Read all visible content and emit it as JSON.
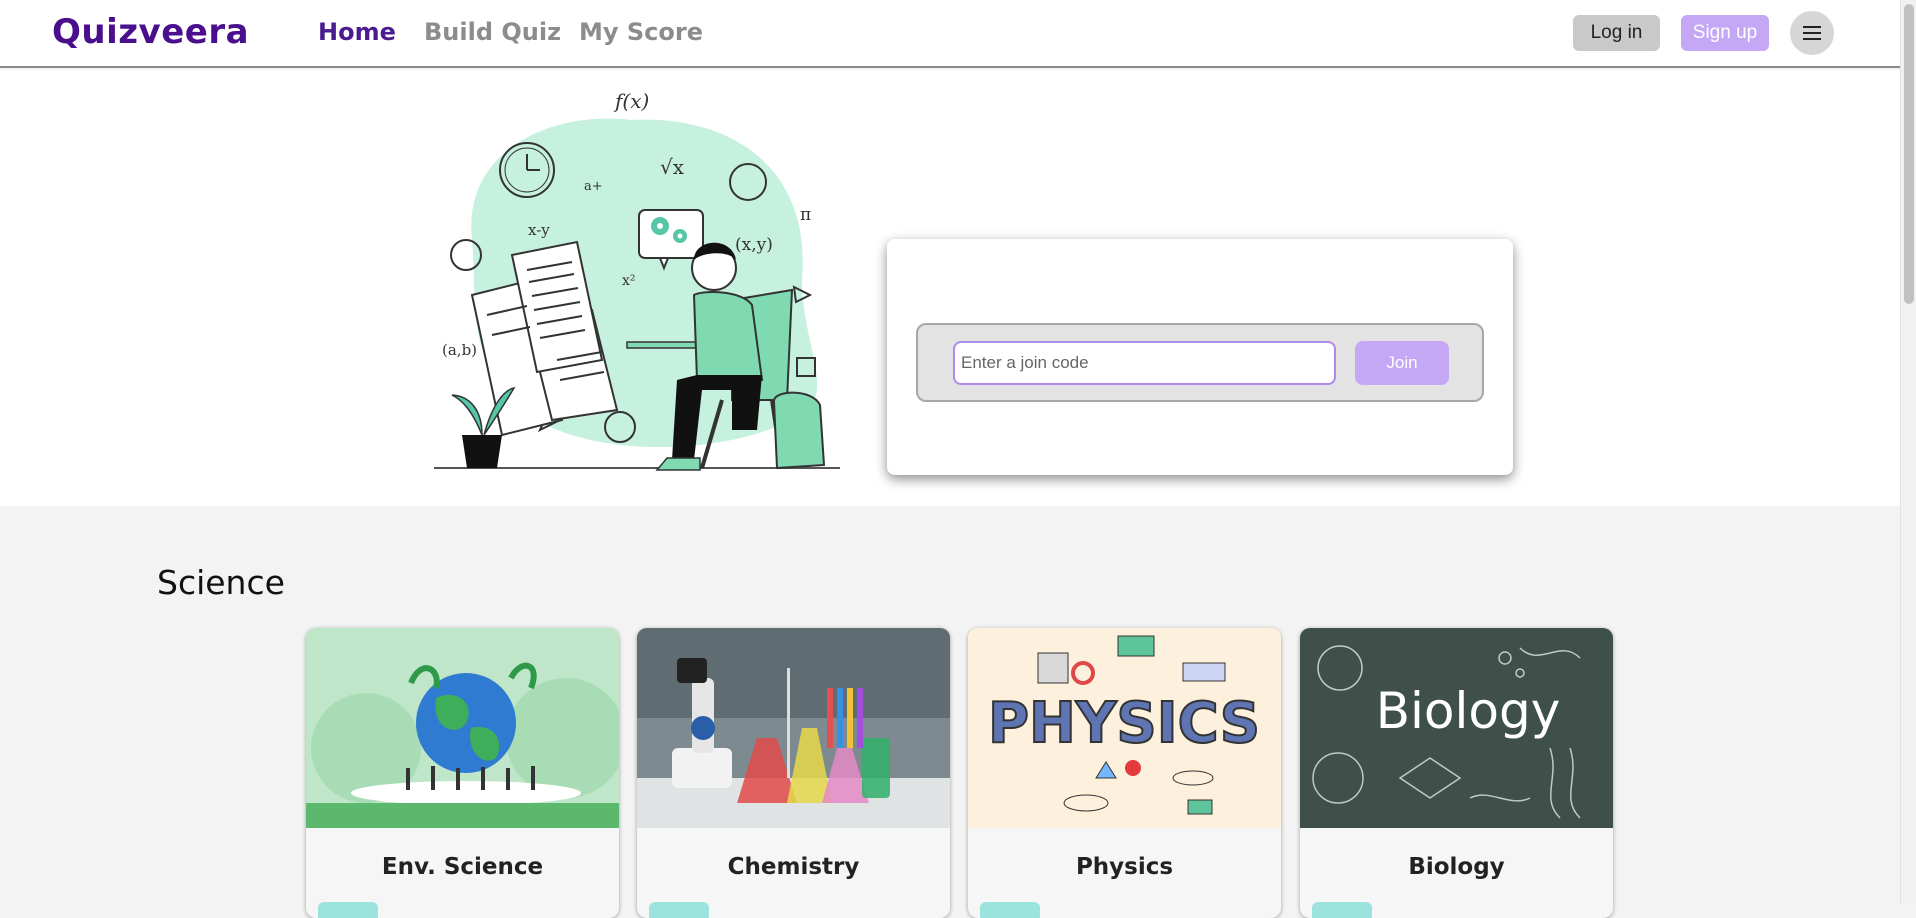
{
  "header": {
    "logo": "Quizveera",
    "nav": [
      {
        "label": "Home",
        "active": true
      },
      {
        "label": "Build Quiz",
        "active": false
      },
      {
        "label": "My Score",
        "active": false
      }
    ],
    "login_label": "Log in",
    "signup_label": "Sign up",
    "menu_icon": "hamburger-icon"
  },
  "join": {
    "placeholder": "Enter a join code",
    "value": "",
    "button_label": "Join"
  },
  "illustration": {
    "formula_labels": [
      "f(x)",
      "√x",
      "x-y",
      "(x,y)",
      "x²",
      "(a,b)",
      "π",
      "a+"
    ]
  },
  "section": {
    "title": "Science",
    "cards": [
      {
        "title": "Env. Science",
        "image": "earth-illustration"
      },
      {
        "title": "Chemistry",
        "image": "lab-equipment-photo"
      },
      {
        "title": "Physics",
        "image": "physics-doodles"
      },
      {
        "title": "Biology",
        "image": "biology-chalkboard"
      }
    ],
    "image_texts": {
      "physics": "PHYSICS",
      "biology": "Biology"
    }
  },
  "colors": {
    "brand": "#4a0f8c",
    "accent": "#c5a8f5",
    "mint": "#c6f1df",
    "tag": "#9be3dc"
  }
}
